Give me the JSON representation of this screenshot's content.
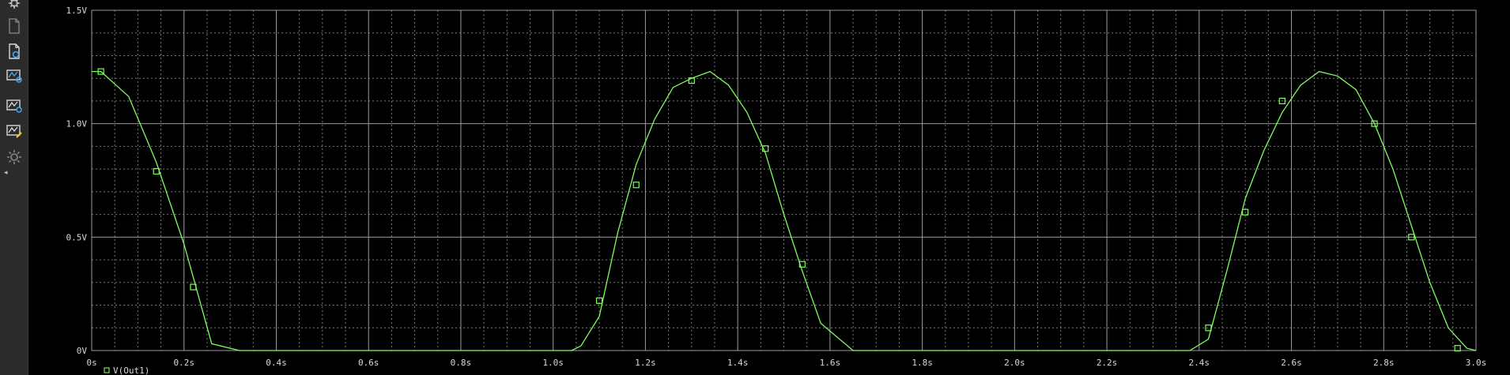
{
  "colors": {
    "background": "#000000",
    "grid_major": "#9a9a9a",
    "grid_minor": "#7a7a7a",
    "trace": "#7cff5c",
    "text": "#d8d8d8",
    "toolbar_bg": "#2b2b2b",
    "icon": "#c8c8c8",
    "icon_accent": "#3fa9f5",
    "icon_highlight": "#f5d000"
  },
  "toolbar": {
    "icons": [
      {
        "name": "settings-icon"
      },
      {
        "name": "new-page-icon"
      },
      {
        "name": "zoom-fit-icon"
      },
      {
        "name": "waveform-settings-icon"
      },
      {
        "name": "waveform-edit-icon"
      },
      {
        "name": "gear-icon"
      }
    ],
    "collapse": "◂"
  },
  "chart_data": {
    "type": "line",
    "title": "",
    "xlabel": "",
    "ylabel": "",
    "xlim": [
      0,
      3.0
    ],
    "ylim": [
      0,
      1.5
    ],
    "grid": true,
    "x_ticks": [
      {
        "value": 0,
        "label": "0s"
      },
      {
        "value": 0.2,
        "label": "0.2s"
      },
      {
        "value": 0.4,
        "label": "0.4s"
      },
      {
        "value": 0.6,
        "label": "0.6s"
      },
      {
        "value": 0.8,
        "label": "0.8s"
      },
      {
        "value": 1.0,
        "label": "1.0s"
      },
      {
        "value": 1.2,
        "label": "1.2s"
      },
      {
        "value": 1.4,
        "label": "1.4s"
      },
      {
        "value": 1.6,
        "label": "1.6s"
      },
      {
        "value": 1.8,
        "label": "1.8s"
      },
      {
        "value": 2.0,
        "label": "2.0s"
      },
      {
        "value": 2.2,
        "label": "2.2s"
      },
      {
        "value": 2.4,
        "label": "2.4s"
      },
      {
        "value": 2.6,
        "label": "2.6s"
      },
      {
        "value": 2.8,
        "label": "2.8s"
      },
      {
        "value": 3.0,
        "label": "3.0s"
      }
    ],
    "y_ticks": [
      {
        "value": 0,
        "label": "0V"
      },
      {
        "value": 0.5,
        "label": "0.5V"
      },
      {
        "value": 1.0,
        "label": "1.0V"
      },
      {
        "value": 1.5,
        "label": "1.5V"
      }
    ],
    "series": [
      {
        "name": "V(Out1)",
        "x": [
          0,
          0.02,
          0.08,
          0.14,
          0.2,
          0.26,
          0.32,
          1.0,
          1.04,
          1.06,
          1.1,
          1.14,
          1.18,
          1.22,
          1.26,
          1.3,
          1.34,
          1.38,
          1.42,
          1.46,
          1.5,
          1.54,
          1.58,
          1.65,
          1.8,
          2.2,
          2.38,
          2.42,
          2.46,
          2.5,
          2.54,
          2.58,
          2.62,
          2.66,
          2.7,
          2.74,
          2.78,
          2.82,
          2.86,
          2.9,
          2.94,
          2.98,
          3.0
        ],
        "y": [
          1.23,
          1.23,
          1.12,
          0.83,
          0.47,
          0.03,
          0.0,
          0.0,
          0.0,
          0.02,
          0.15,
          0.52,
          0.82,
          1.02,
          1.16,
          1.2,
          1.23,
          1.17,
          1.05,
          0.87,
          0.6,
          0.35,
          0.12,
          0.0,
          0.0,
          0.0,
          0.0,
          0.05,
          0.35,
          0.67,
          0.88,
          1.05,
          1.17,
          1.23,
          1.21,
          1.15,
          1.0,
          0.8,
          0.55,
          0.3,
          0.1,
          0.01,
          0.0
        ],
        "markers": [
          {
            "x": 0.02,
            "y": 1.23
          },
          {
            "x": 0.14,
            "y": 0.79
          },
          {
            "x": 0.22,
            "y": 0.28
          },
          {
            "x": 1.1,
            "y": 0.22
          },
          {
            "x": 1.18,
            "y": 0.73
          },
          {
            "x": 1.3,
            "y": 1.19
          },
          {
            "x": 1.46,
            "y": 0.89
          },
          {
            "x": 1.54,
            "y": 0.38
          },
          {
            "x": 2.42,
            "y": 0.1
          },
          {
            "x": 2.5,
            "y": 0.61
          },
          {
            "x": 2.58,
            "y": 1.1
          },
          {
            "x": 2.78,
            "y": 1.0
          },
          {
            "x": 2.86,
            "y": 0.5
          },
          {
            "x": 2.96,
            "y": 0.01
          }
        ]
      }
    ],
    "legend": [
      {
        "label": "V(Out1)"
      }
    ]
  }
}
